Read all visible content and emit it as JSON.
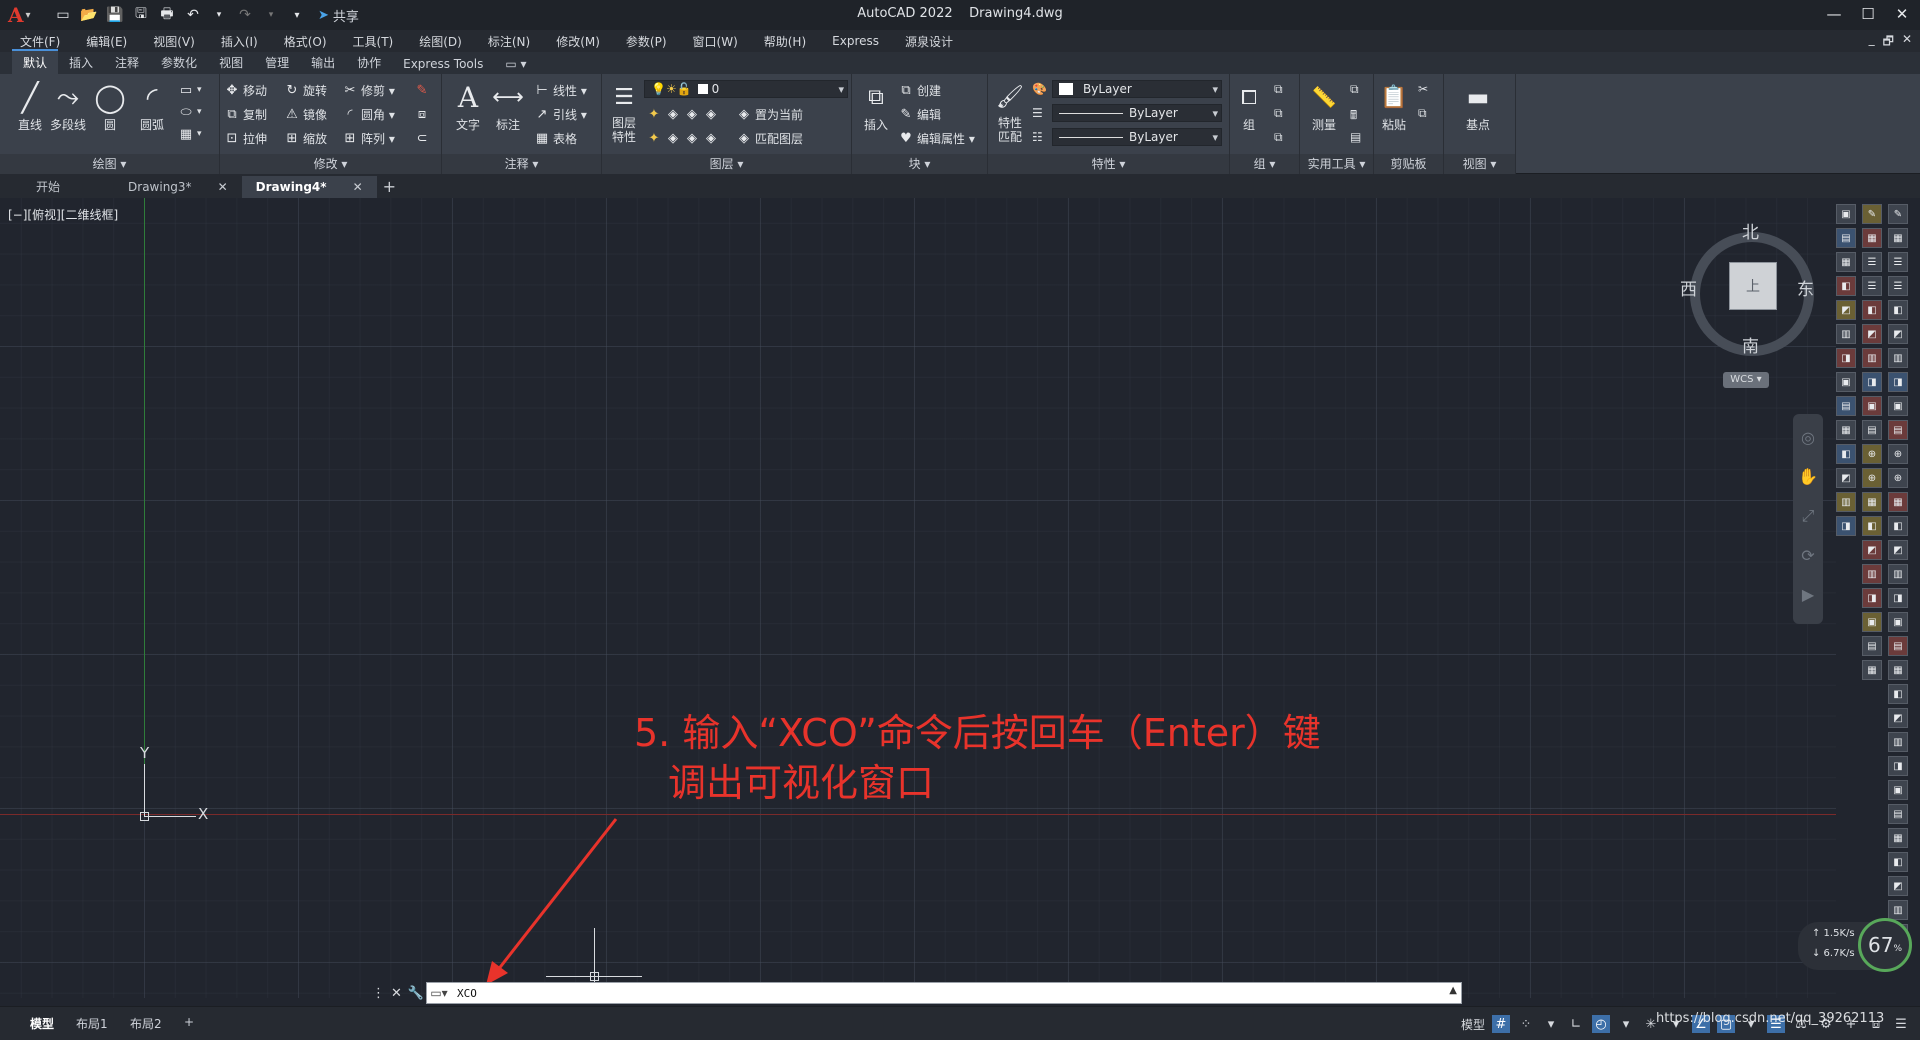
{
  "title_bar": {
    "logo": "A",
    "share_label": "共享",
    "app_title": "AutoCAD 2022    Drawing4.dwg",
    "minimize": "—",
    "restore": "☐",
    "close": "✕"
  },
  "menu": {
    "items": [
      "文件(F)",
      "编辑(E)",
      "视图(V)",
      "插入(I)",
      "格式(O)",
      "工具(T)",
      "绘图(D)",
      "标注(N)",
      "修改(M)",
      "参数(P)",
      "窗口(W)",
      "帮助(H)",
      "Express",
      "源泉设计"
    ]
  },
  "ribbon_tabs": [
    "默认",
    "插入",
    "注释",
    "参数化",
    "视图",
    "管理",
    "输出",
    "协作",
    "Express Tools",
    "▭ ▾"
  ],
  "ribbon": {
    "draw": {
      "title": "绘图 ▾",
      "line": "直线",
      "polyline": "多段线",
      "circle": "圆",
      "arc": "圆弧"
    },
    "modify": {
      "title": "修改 ▾",
      "move": "移动",
      "rotate": "旋转",
      "trim": "修剪 ▾",
      "copy": "复制",
      "mirror": "镜像",
      "fillet": "圆角 ▾",
      "stretch": "拉伸",
      "scale": "缩放",
      "array": "阵列 ▾"
    },
    "annotation": {
      "title": "注释 ▾",
      "text": "文字",
      "dimension": "标注",
      "linear": "线性 ▾",
      "leader": "引线 ▾",
      "table": "表格"
    },
    "layers": {
      "title": "图层 ▾",
      "props": "图层\n特性",
      "layer_value": "0",
      "set_current": "置为当前",
      "match_layer": "匹配图层"
    },
    "block": {
      "title": "块 ▾",
      "insert": "插入",
      "create": "创建",
      "edit": "编辑",
      "edit_attr": "编辑属性 ▾"
    },
    "properties": {
      "title": "特性 ▾",
      "match": "特性\n匹配",
      "color": "ByLayer",
      "linetype": "ByLayer",
      "lineweight": "ByLayer"
    },
    "groups": {
      "title": "组 ▾",
      "group": "组"
    },
    "utilities": {
      "title": "实用工具 ▾",
      "measure": "测量"
    },
    "clipboard": {
      "title": "剪贴板",
      "paste": "粘贴"
    },
    "view": {
      "title": "视图 ▾",
      "base": "基点"
    }
  },
  "file_tabs": [
    {
      "label": "开始",
      "active": false,
      "closable": false
    },
    {
      "label": "Drawing3*",
      "active": false,
      "closable": true
    },
    {
      "label": "Drawing4*",
      "active": true,
      "closable": true
    }
  ],
  "viewport": {
    "label": "[−][俯视][二维线框]",
    "ucs_y": "Y",
    "ucs_x": "X"
  },
  "viewcube": {
    "north": "北",
    "south": "南",
    "east": "东",
    "west": "西",
    "face": "上",
    "wcs": "WCS ▾"
  },
  "annotation": {
    "line1": "5. 输入“XCO”命令后按回车（Enter）键",
    "line2": "调出可视化窗口",
    "color": "#e8332b"
  },
  "command_line": {
    "value": "XCO"
  },
  "netspeed": {
    "up": "↑ 1.5K/s",
    "down": "↓ 6.7K/s",
    "percent": "67",
    "unit": "%"
  },
  "status_bar": {
    "layout_tabs": [
      "模型",
      "布局1",
      "布局2",
      "+"
    ],
    "model_label": "模型",
    "watermark": "https://blog.csdn.net/qq_39262113"
  }
}
